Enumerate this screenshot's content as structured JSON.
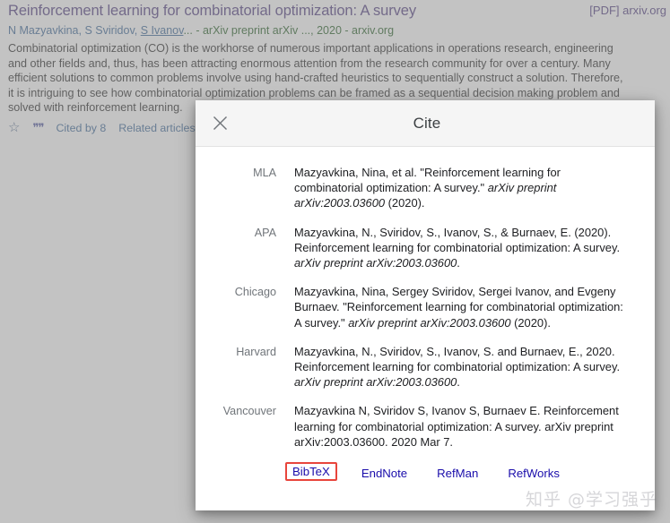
{
  "search_result": {
    "title": "Reinforcement learning for combinatorial optimization: A survey",
    "authors_prefix": "N Mazyavkina, S Sviridov, ",
    "authors_underlined": "S Ivanov",
    "meta_tail": "... - arXiv preprint arXiv ..., 2020 - arxiv.org",
    "snippet": "Combinatorial optimization (CO) is the workhorse of numerous important applications in operations research, engineering and other fields and, thus, has been attracting enormous attention from the research community for over a century. Many efficient solutions to common problems involve using hand-crafted heuristics to sequentially construct a solution. Therefore, it is intriguing to see how combinatorial optimization problems can be framed as a sequential decision making problem and solved with reinforcement learning.",
    "pdf_link": "[PDF] arxiv.org",
    "links": {
      "save_icon": "star-icon",
      "cite_icon": "quote-icon",
      "cited_by": "Cited by 8",
      "related": "Related articles"
    }
  },
  "modal": {
    "title": "Cite",
    "close_icon": "close-icon",
    "citations": [
      {
        "label": "MLA",
        "segments": [
          {
            "text": "Mazyavkina, Nina, et al. \"Reinforcement learning for combinatorial optimization: A survey.\" ",
            "italic": false
          },
          {
            "text": "arXiv preprint arXiv:2003.03600",
            "italic": true
          },
          {
            "text": " (2020).",
            "italic": false
          }
        ]
      },
      {
        "label": "APA",
        "segments": [
          {
            "text": "Mazyavkina, N., Sviridov, S., Ivanov, S., & Burnaev, E. (2020). Reinforcement learning for combinatorial optimization: A survey. ",
            "italic": false
          },
          {
            "text": "arXiv preprint arXiv:2003.03600",
            "italic": true
          },
          {
            "text": ".",
            "italic": false
          }
        ]
      },
      {
        "label": "Chicago",
        "segments": [
          {
            "text": "Mazyavkina, Nina, Sergey Sviridov, Sergei Ivanov, and Evgeny Burnaev. \"Reinforcement learning for combinatorial optimization: A survey.\" ",
            "italic": false
          },
          {
            "text": "arXiv preprint arXiv:2003.03600",
            "italic": true
          },
          {
            "text": " (2020).",
            "italic": false
          }
        ]
      },
      {
        "label": "Harvard",
        "segments": [
          {
            "text": "Mazyavkina, N., Sviridov, S., Ivanov, S. and Burnaev, E., 2020. Reinforcement learning for combinatorial optimization: A survey. ",
            "italic": false
          },
          {
            "text": "arXiv preprint arXiv:2003.03600",
            "italic": true
          },
          {
            "text": ".",
            "italic": false
          }
        ]
      },
      {
        "label": "Vancouver",
        "segments": [
          {
            "text": "Mazyavkina N, Sviridov S, Ivanov S, Burnaev E. Reinforcement learning for combinatorial optimization: A survey. arXiv preprint arXiv:2003.03600. 2020 Mar 7.",
            "italic": false
          }
        ]
      }
    ],
    "export_links": [
      {
        "label": "BibTeX",
        "highlighted": true
      },
      {
        "label": "EndNote",
        "highlighted": false
      },
      {
        "label": "RefMan",
        "highlighted": false
      },
      {
        "label": "RefWorks",
        "highlighted": false
      }
    ]
  },
  "watermark": "知乎 @学习强乎",
  "colors": {
    "link_blue": "#1a0dab",
    "visited_purple": "#6b5b95",
    "highlight_red": "#e8453c",
    "modal_header_bg": "#f5f5f5"
  }
}
